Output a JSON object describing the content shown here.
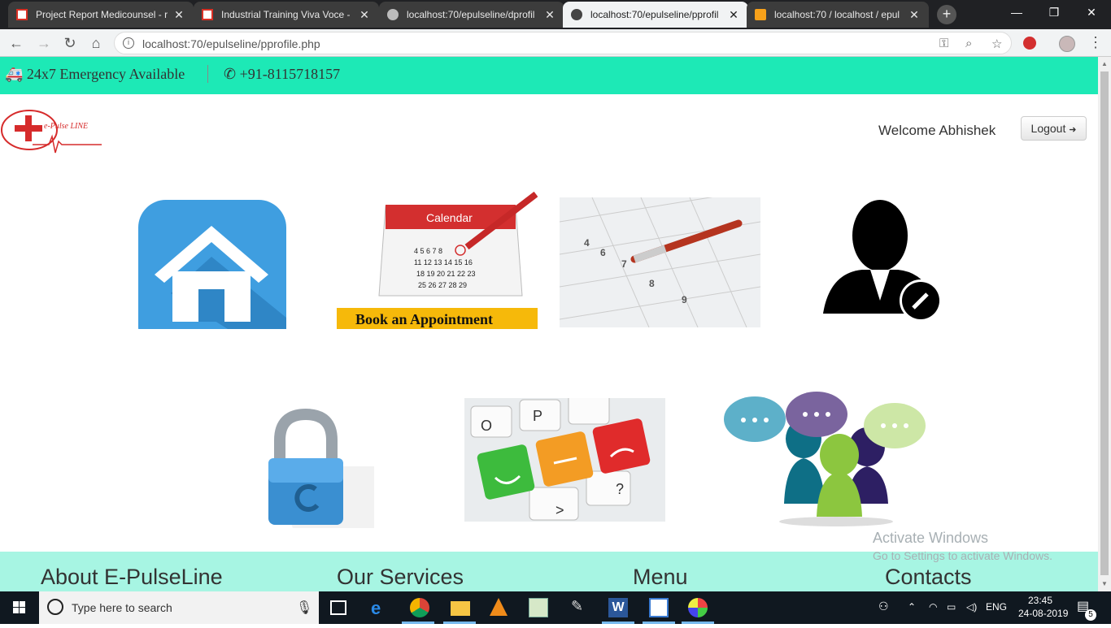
{
  "browser": {
    "tabs": [
      {
        "title": "Project Report Medicounsel - r",
        "icon": "gmail-icon",
        "active": false
      },
      {
        "title": "Industrial Training Viva Voce - ",
        "icon": "gmail-icon",
        "active": false
      },
      {
        "title": "localhost:70/epulseline/dprofil",
        "icon": "globe-icon",
        "active": false
      },
      {
        "title": "localhost:70/epulseline/pprofil",
        "icon": "globe-icon",
        "active": true
      },
      {
        "title": "localhost:70 / localhost / epul",
        "icon": "phpmyadmin-icon",
        "active": false
      }
    ],
    "url": "localhost:70/epulseline/pprofile.php"
  },
  "site": {
    "emergency_text": "24x7 Emergency Available",
    "phone_text": "+91-8115718157",
    "logo_text": "e-Pulse LINE",
    "welcome_text": "Welcome Abhishek",
    "logout_label": "Logout",
    "tiles_row1": [
      "home",
      "book-appointment",
      "appointments",
      "edit-profile"
    ],
    "tiles_row2": [
      "change-password",
      "feedback",
      "chat"
    ],
    "calendar_word": "Calendar",
    "book_label": "Book an Appointment",
    "footer": {
      "about": "About E-PulseLine",
      "services": "Our Services",
      "menu": "Menu",
      "contacts": "Contacts"
    }
  },
  "watermark": {
    "line1": "Activate Windows",
    "line2": "Go to Settings to activate Windows."
  },
  "taskbar": {
    "search_placeholder": "Type here to search",
    "lang": "ENG",
    "time": "23:45",
    "date": "24-08-2019",
    "notifications": "5"
  },
  "colors": {
    "accent_teal": "#1de9b6",
    "footer_mint": "#a7f5e3"
  }
}
